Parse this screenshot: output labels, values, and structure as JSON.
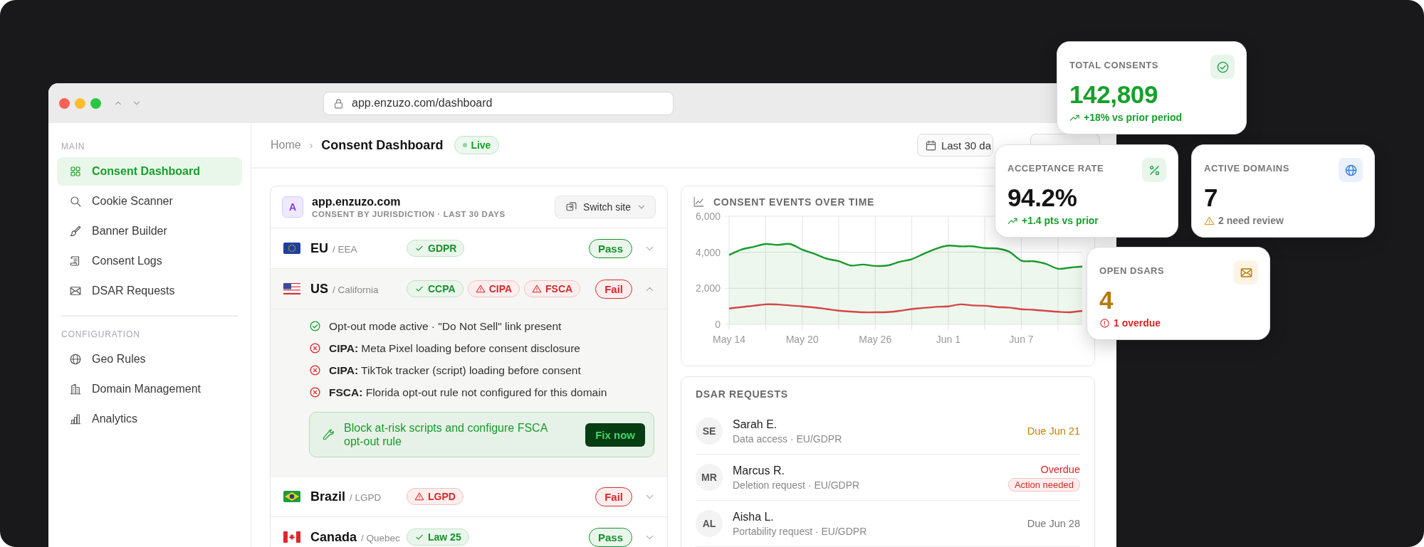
{
  "browser": {
    "url": "app.enzuzo.com/dashboard"
  },
  "sidebar": {
    "sections": [
      {
        "title": "MAIN",
        "items": [
          {
            "label": "Consent Dashboard",
            "selected": true
          },
          {
            "label": "Cookie Scanner",
            "selected": false
          },
          {
            "label": "Banner Builder",
            "selected": false
          },
          {
            "label": "Consent Logs",
            "selected": false
          },
          {
            "label": "DSAR Requests",
            "selected": false
          }
        ]
      },
      {
        "title": "CONFIGURATION",
        "items": [
          {
            "label": "Geo Rules",
            "selected": false
          },
          {
            "label": "Domain Management",
            "selected": false
          },
          {
            "label": "Analytics",
            "selected": false
          }
        ]
      }
    ]
  },
  "header": {
    "breadcrumb": [
      "Home",
      "Consent Dashboard"
    ],
    "separator": "›",
    "badge": "Live",
    "date_button": "Last 30 da"
  },
  "jurisdiction": {
    "avatar": "A",
    "site": "app.enzuzo.com",
    "subtitle": "CONSENT BY JURISDICTION · LAST 30 DAYS",
    "switch_button": "Switch site",
    "rows": [
      {
        "region": "EU",
        "detail": "/ EEA",
        "laws": [
          {
            "label": "GDPR",
            "kind": "pass"
          }
        ],
        "result": "Pass",
        "kind": "pass",
        "expanded": false
      },
      {
        "region": "US",
        "detail": "/ California",
        "laws": [
          {
            "label": "CCPA",
            "kind": "pass"
          },
          {
            "label": "CIPA",
            "kind": "fail"
          },
          {
            "label": "FSCA",
            "kind": "fail"
          }
        ],
        "result": "Fail",
        "kind": "fail",
        "expanded": true,
        "checks": [
          {
            "kind": "pass",
            "text": "Opt-out mode active · \"Do Not Sell\" link present"
          },
          {
            "kind": "fail",
            "text": "**CIPA:** Meta Pixel loading before consent disclosure"
          },
          {
            "kind": "fail",
            "text": "**CIPA:** TikTok tracker (script) loading before consent"
          },
          {
            "kind": "fail",
            "text": "**FSCA:** Florida opt-out rule not configured for this domain"
          }
        ],
        "fix": {
          "text": "Block at-risk scripts and configure FSCA opt-out rule",
          "button": "Fix now"
        }
      },
      {
        "region": "Brazil",
        "detail": "/ LGPD",
        "laws": [
          {
            "label": "LGPD",
            "kind": "fail"
          }
        ],
        "result": "Fail",
        "kind": "fail",
        "expanded": false
      },
      {
        "region": "Canada",
        "detail": "/ Quebec",
        "laws": [
          {
            "label": "Law 25",
            "kind": "pass"
          }
        ],
        "result": "Pass",
        "kind": "pass",
        "expanded": false
      }
    ]
  },
  "events_chart": {
    "title": "CONSENT EVENTS OVER TIME",
    "chart_data": {
      "type": "area",
      "categories": [
        "May 14",
        null,
        null,
        null,
        null,
        null,
        "May 20",
        null,
        null,
        null,
        null,
        null,
        "May 26",
        null,
        null,
        null,
        null,
        null,
        "Jun 1",
        null,
        null,
        null,
        null,
        null,
        "Jun 7",
        null,
        null,
        null,
        null,
        null
      ],
      "ylim": [
        0,
        6000
      ],
      "grid": true,
      "yticks": [
        0,
        {
          "value": 2000,
          "label": "2,000"
        },
        {
          "value": 4000,
          "label": "4,000"
        },
        {
          "value": 6000,
          "label": "6,000"
        }
      ],
      "series": [
        {
          "type": "area",
          "color": "#1a9a2c",
          "values": [
            3850,
            4150,
            4300,
            4460,
            4410,
            4460,
            4150,
            3920,
            3650,
            3510,
            3270,
            3320,
            3240,
            3270,
            3470,
            3620,
            3920,
            4200,
            4370,
            4330,
            4330,
            4230,
            4210,
            4030,
            3540,
            3500,
            3360,
            3090,
            3150,
            3210
          ]
        },
        {
          "type": "line",
          "color": "#d64545",
          "values": [
            880,
            960,
            1030,
            1110,
            1100,
            1050,
            1000,
            940,
            850,
            760,
            710,
            670,
            670,
            680,
            750,
            850,
            910,
            970,
            1000,
            1110,
            1050,
            1030,
            960,
            930,
            840,
            810,
            750,
            700,
            670,
            750
          ]
        }
      ]
    }
  },
  "dsar": {
    "title": "DSAR REQUESTS",
    "requests": [
      {
        "initials": "SE",
        "name": "Sarah E.",
        "detail": "Data access · EU/GDPR",
        "due": "Due Jun 21",
        "color": "#c08306"
      },
      {
        "initials": "MR",
        "name": "Marcus R.",
        "detail": "Deletion request · EU/GDPR",
        "due": "Overdue",
        "color": "#dc2626",
        "badge": "Action needed"
      },
      {
        "initials": "AL",
        "name": "Aisha L.",
        "detail": "Portability request · EU/GDPR",
        "due": "Due Jun 28",
        "color": "#777777"
      }
    ]
  },
  "stats": [
    {
      "label": "TOTAL CONSENTS",
      "value": {
        "text": "142,809",
        "color": "#17a02a"
      },
      "delta": {
        "text": "+18% vs prior period",
        "kind": "positive"
      }
    },
    {
      "label": "ACCEPTANCE RATE",
      "value": {
        "text": "94.2%",
        "color": "#141414"
      },
      "delta": {
        "text": "+1.4 pts vs prior",
        "kind": "positive"
      }
    },
    {
      "label": "ACTIVE DOMAINS",
      "value": {
        "text": "7",
        "color": "#141414"
      },
      "delta": {
        "text": "2 need review",
        "kind": "warning"
      }
    },
    {
      "label": "OPEN DSARS",
      "value": {
        "text": "4",
        "color": "#b7770b"
      },
      "delta": {
        "text": "1 overdue",
        "kind": "negative"
      }
    }
  ]
}
